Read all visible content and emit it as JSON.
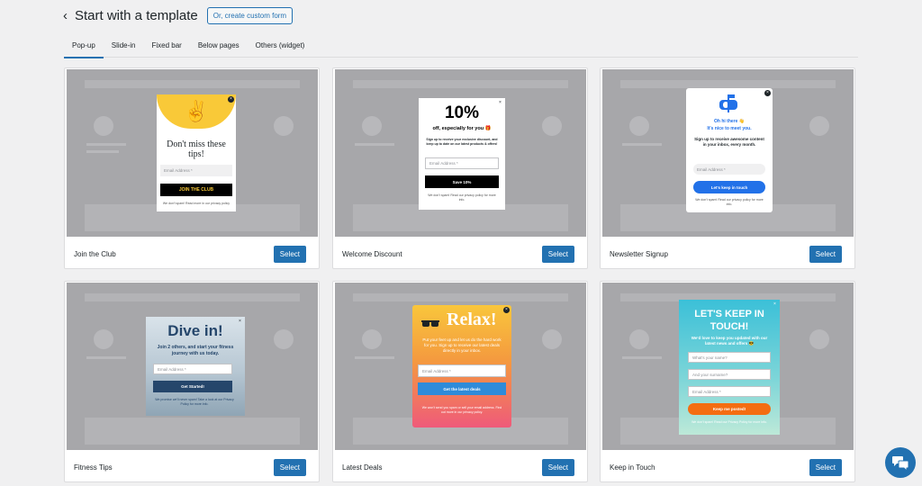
{
  "header": {
    "back_icon": "chevron-left-icon",
    "title": "Start with a template",
    "custom_form_label": "Or, create custom form"
  },
  "tabs": [
    {
      "label": "Pop-up",
      "active": true
    },
    {
      "label": "Slide-in"
    },
    {
      "label": "Fixed bar"
    },
    {
      "label": "Below pages"
    },
    {
      "label": "Others (widget)"
    }
  ],
  "select_label": "Select",
  "templates": [
    {
      "name": "Join the Club",
      "popup": {
        "heading": "Don't miss these tips!",
        "input": "Email Address *",
        "button": "JOIN THE CLUB",
        "footnote": "We don't spam! Read more in our privacy policy"
      }
    },
    {
      "name": "Welcome Discount",
      "popup": {
        "heading": "10%",
        "subheading": "off, especially for you 🎁",
        "text": "Sign up to receive your exclusive discount, and keep up to date on our latest products & offers!",
        "input": "Email Address *",
        "button": "Save 10%",
        "footnote": "We don't spam! Read our privacy policy for more info."
      }
    },
    {
      "name": "Newsletter Signup",
      "popup": {
        "heading": "Oh hi there 👋\nIt's nice to meet you.",
        "text": "Sign up to receive awesome content in your inbox, every month.",
        "input": "Email Address *",
        "button": "Let's keep in touch",
        "footnote": "We don't spam! Read our privacy policy for more info."
      }
    },
    {
      "name": "Fitness Tips",
      "popup": {
        "heading": "Dive in!",
        "text": "Join 2 others, and start your fitness journey with us today.",
        "input": "Email Address *",
        "button": "Get Started!",
        "footnote": "We promise we'll never spam! Take a look at our Privacy Policy for more info."
      }
    },
    {
      "name": "Latest Deals",
      "popup": {
        "heading": "Relax!",
        "text": "Put your feet up and let us do the hard work for you. Sign up to receive our latest deals directly in your inbox.",
        "input": "Email Address *",
        "button": "Get the latest deals",
        "footnote": "We won't send you spam or sell your email address. Find out more in our privacy policy."
      }
    },
    {
      "name": "Keep in Touch",
      "popup": {
        "heading": "LET'S KEEP IN TOUCH!",
        "text": "We'd love to keep you updated with our latest news and offers 😎",
        "inputs": [
          "What's your name?",
          "And your surname?",
          "Email Address *"
        ],
        "button": "Keep me posted!",
        "footnote": "We don't spam! Read our Privacy Policy for more info."
      }
    }
  ],
  "chat_icon": "chat-bubbles-icon"
}
